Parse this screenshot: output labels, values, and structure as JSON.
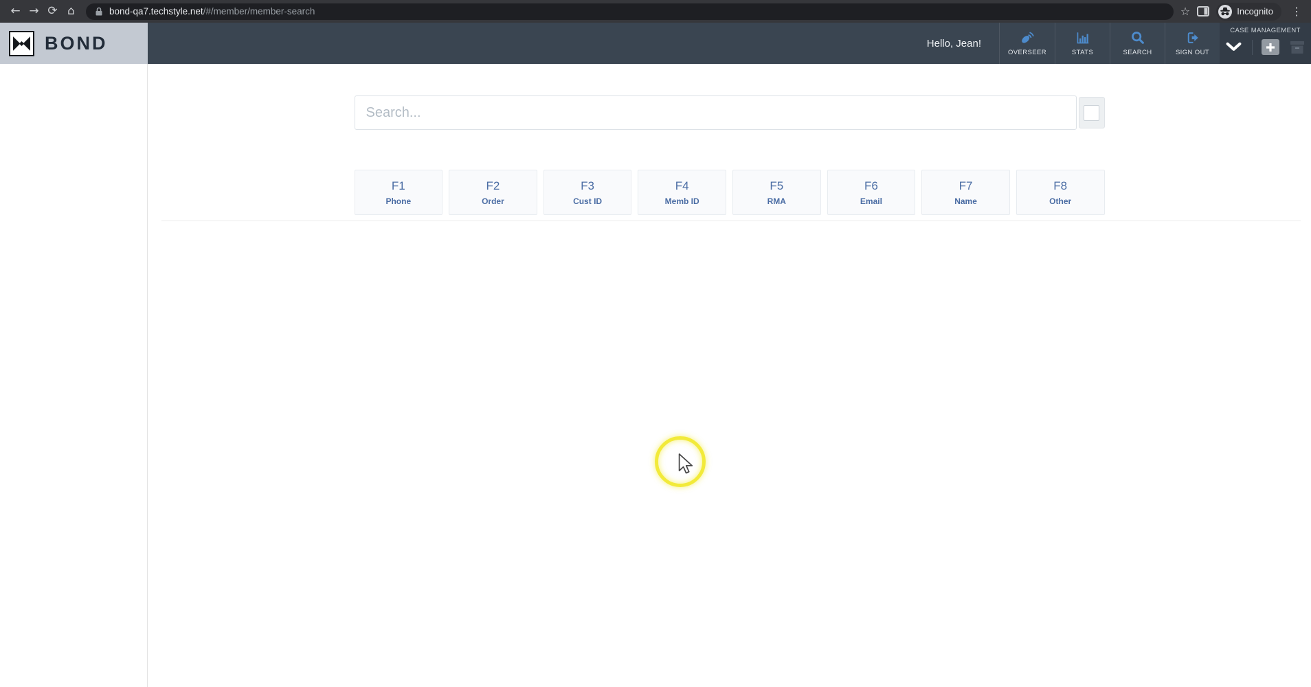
{
  "browser": {
    "url_domain": "bond-qa7.techstyle.net",
    "url_path": "/#/member/member-search",
    "incognito_label": "Incognito",
    "icons": {
      "back": "←",
      "forward": "→",
      "reload": "⟳",
      "home": "⌂",
      "star": "☆",
      "menu": "⋮"
    }
  },
  "app": {
    "brand": "BOND",
    "greeting": "Hello, Jean!",
    "nav_items": [
      {
        "label": "OVERSEER",
        "icon": "overseer-dish-icon"
      },
      {
        "label": "STATS",
        "icon": "stats-chart-icon"
      },
      {
        "label": "SEARCH",
        "icon": "search-icon"
      },
      {
        "label": "SIGN OUT",
        "icon": "sign-out-icon"
      }
    ],
    "case_management": {
      "title": "CASE MANAGEMENT"
    }
  },
  "search": {
    "placeholder": "Search..."
  },
  "hotkeys": [
    {
      "key": "F1",
      "label": "Phone"
    },
    {
      "key": "F2",
      "label": "Order"
    },
    {
      "key": "F3",
      "label": "Cust ID"
    },
    {
      "key": "F4",
      "label": "Memb ID"
    },
    {
      "key": "F5",
      "label": "RMA"
    },
    {
      "key": "F6",
      "label": "Email"
    },
    {
      "key": "F7",
      "label": "Name"
    },
    {
      "key": "F8",
      "label": "Other"
    }
  ],
  "colors": {
    "navbar_bg": "#3a4551",
    "nav_icon_blue": "#4d8bcc",
    "hotkey_text": "#4b6da4",
    "click_ring_yellow": "#f2ea3a",
    "brand_bg": "#c3c9d2"
  }
}
